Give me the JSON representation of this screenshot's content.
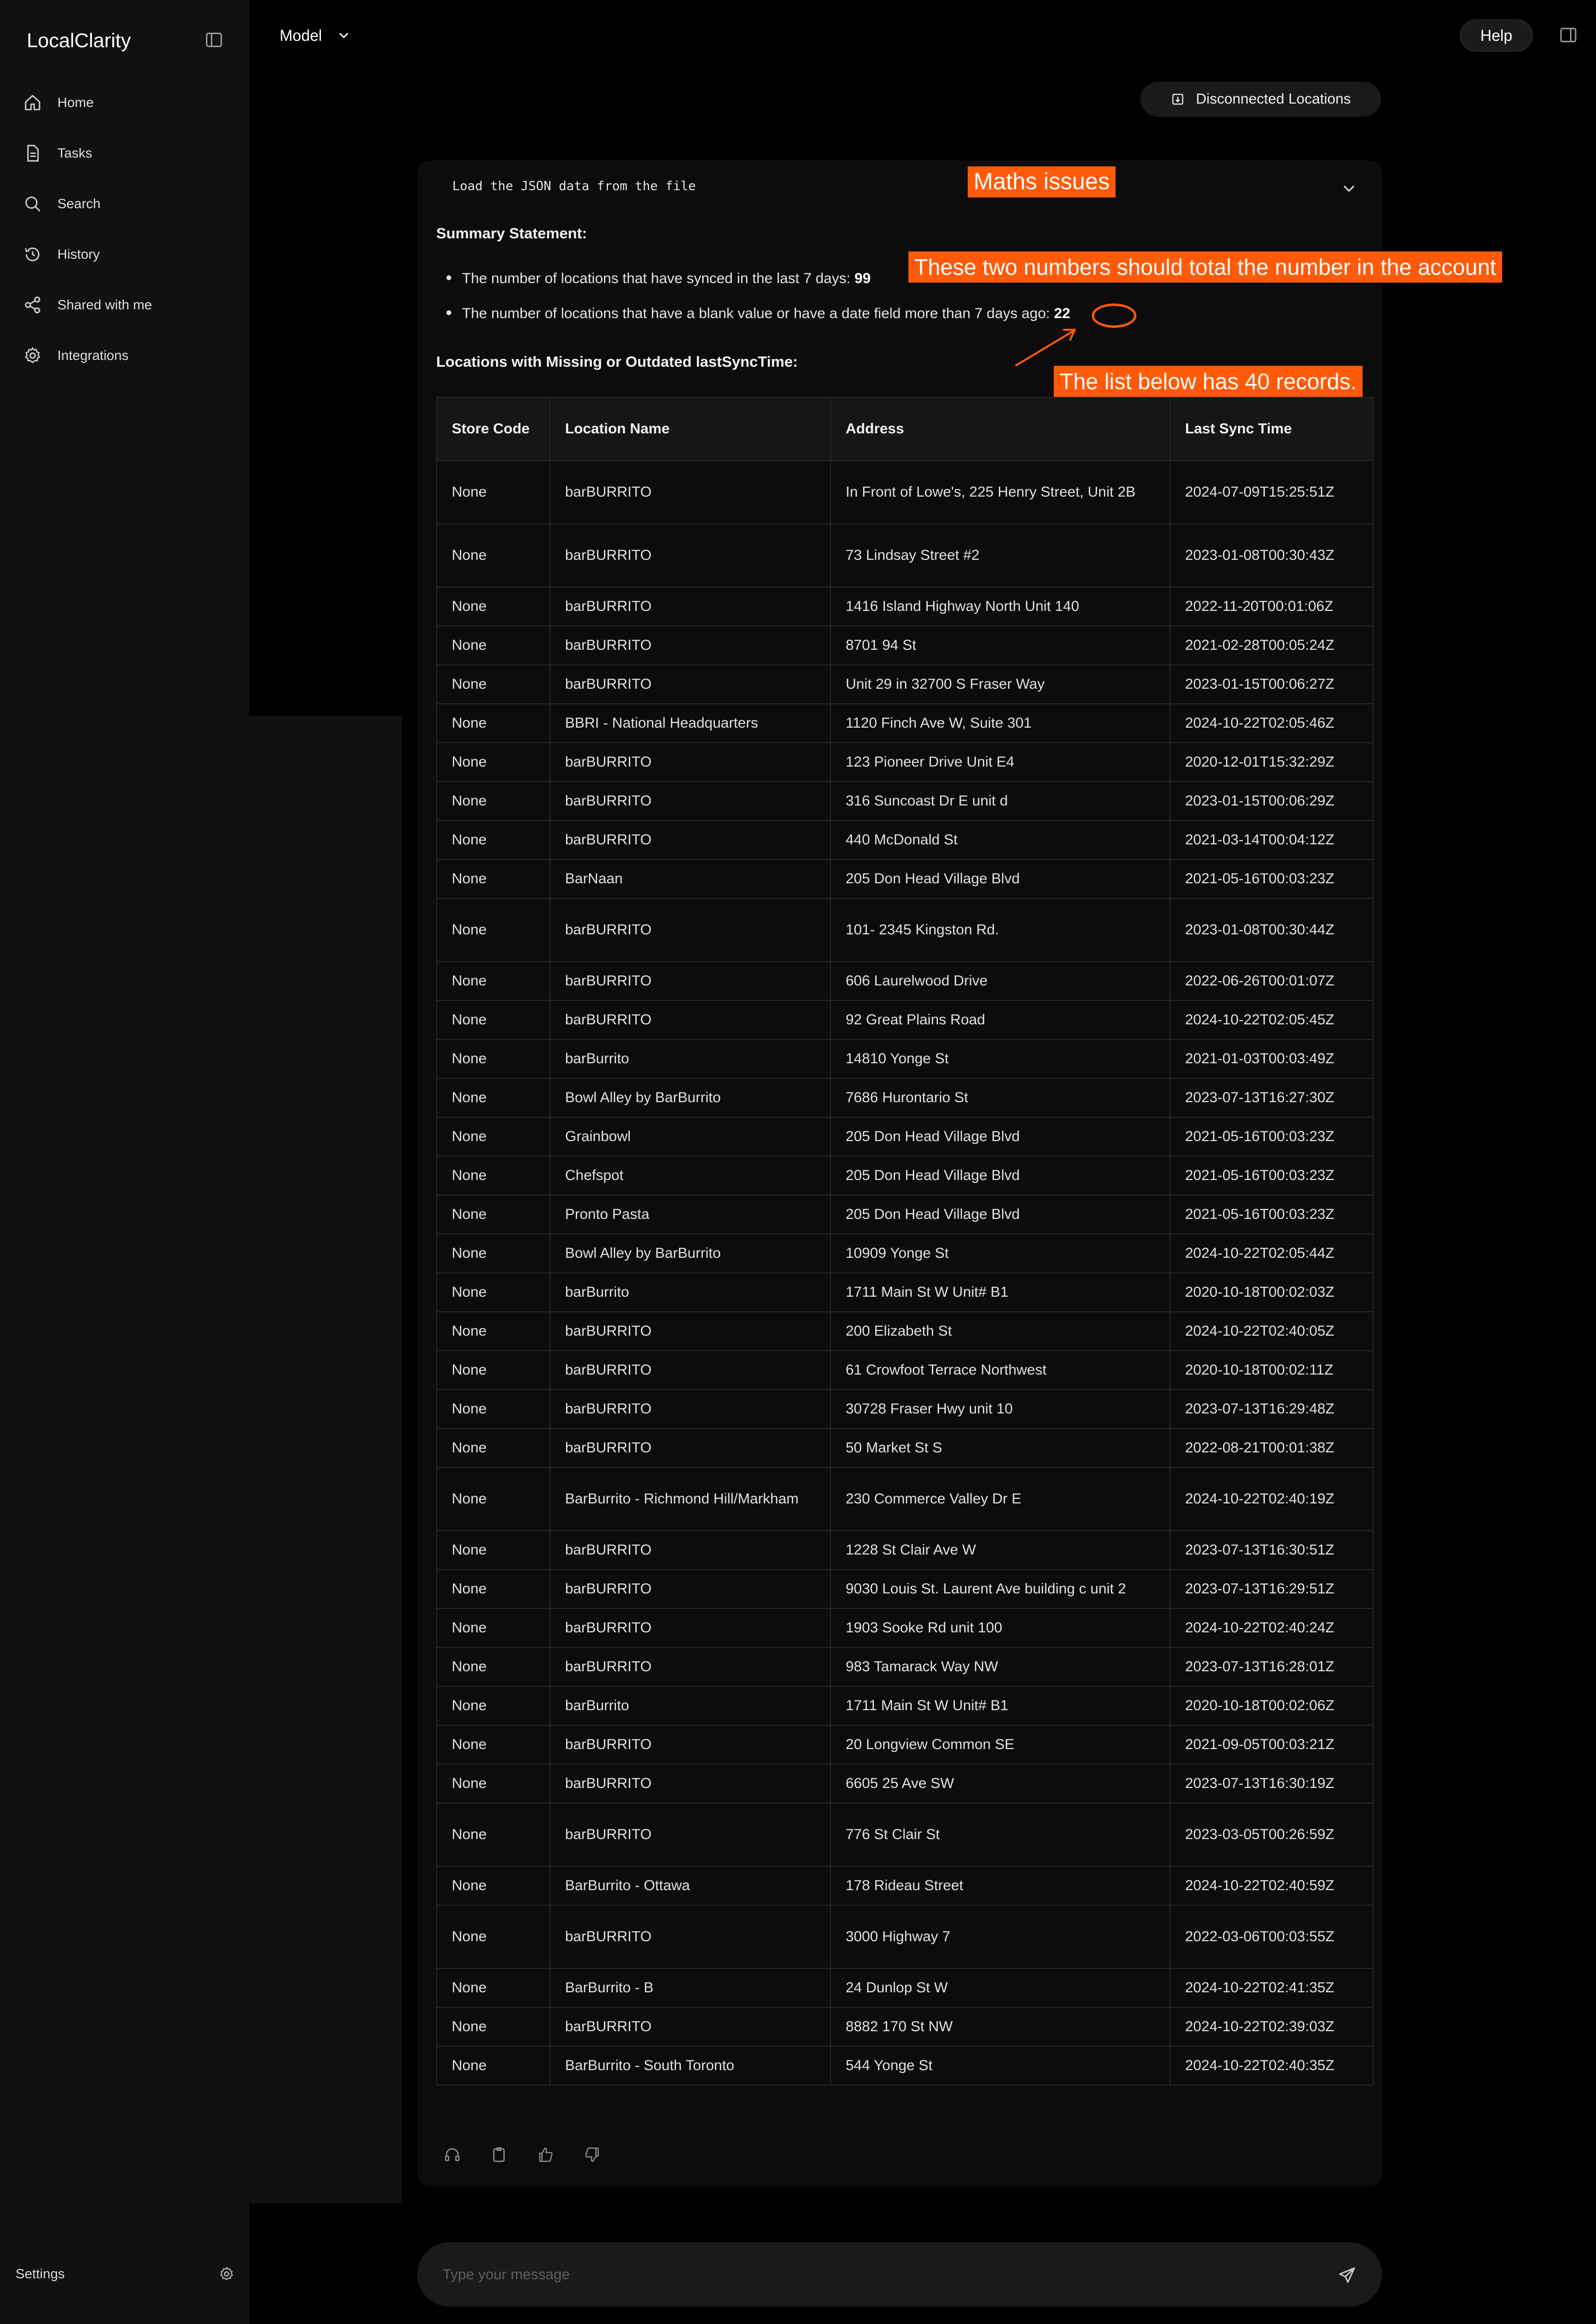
{
  "app": {
    "name": "LocalClarity"
  },
  "sidebar": {
    "items": [
      {
        "label": "Home",
        "icon": "home-icon"
      },
      {
        "label": "Tasks",
        "icon": "document-icon"
      },
      {
        "label": "Search",
        "icon": "search-icon"
      },
      {
        "label": "History",
        "icon": "history-icon"
      },
      {
        "label": "Shared with me",
        "icon": "share-icon"
      },
      {
        "label": "Integrations",
        "icon": "gear-icon"
      }
    ],
    "settings_label": "Settings"
  },
  "header": {
    "model_label": "Model",
    "help_label": "Help",
    "disconnected_label": "Disconnected Locations"
  },
  "response": {
    "code_line": "Load the JSON data from the file",
    "summary_heading": "Summary Statement:",
    "bullet1_text": "The number of locations that have synced in the last 7 days: ",
    "bullet1_value": "99",
    "bullet2_text": "The number of locations that have a blank value or have a date field more than 7 days ago: ",
    "bullet2_value": "22",
    "list_heading": "Locations with Missing or Outdated lastSyncTime:",
    "table": {
      "headers": [
        "Store Code",
        "Location Name",
        "Address",
        "Last Sync Time"
      ],
      "rows": [
        [
          "None",
          "barBURRITO",
          "In Front of Lowe's, 225 Henry Street, Unit 2B",
          "2024-07-09T15:25:51Z"
        ],
        [
          "None",
          "barBURRITO",
          "73 Lindsay Street #2",
          "2023-01-08T00:30:43Z"
        ],
        [
          "None",
          "barBURRITO",
          "1416 Island Highway North Unit 140",
          "2022-11-20T00:01:06Z"
        ],
        [
          "None",
          "barBURRITO",
          "8701 94 St",
          "2021-02-28T00:05:24Z"
        ],
        [
          "None",
          "barBURRITO",
          "Unit 29 in 32700 S Fraser Way",
          "2023-01-15T00:06:27Z"
        ],
        [
          "None",
          "BBRI - National Headquarters",
          "1120 Finch Ave W, Suite 301",
          "2024-10-22T02:05:46Z"
        ],
        [
          "None",
          "barBURRITO",
          "123 Pioneer Drive Unit E4",
          "2020-12-01T15:32:29Z"
        ],
        [
          "None",
          "barBURRITO",
          "316 Suncoast Dr E unit d",
          "2023-01-15T00:06:29Z"
        ],
        [
          "None",
          "barBURRITO",
          "440 McDonald St",
          "2021-03-14T00:04:12Z"
        ],
        [
          "None",
          "BarNaan",
          "205 Don Head Village Blvd",
          "2021-05-16T00:03:23Z"
        ],
        [
          "None",
          "barBURRITO",
          "101- 2345 Kingston Rd.",
          "2023-01-08T00:30:44Z"
        ],
        [
          "None",
          "barBURRITO",
          "606 Laurelwood Drive",
          "2022-06-26T00:01:07Z"
        ],
        [
          "None",
          "barBURRITO",
          "92 Great Plains Road",
          "2024-10-22T02:05:45Z"
        ],
        [
          "None",
          "barBurrito",
          "14810 Yonge St",
          "2021-01-03T00:03:49Z"
        ],
        [
          "None",
          "Bowl Alley by BarBurrito",
          "7686 Hurontario St",
          "2023-07-13T16:27:30Z"
        ],
        [
          "None",
          "Grainbowl",
          "205 Don Head Village Blvd",
          "2021-05-16T00:03:23Z"
        ],
        [
          "None",
          "Chefspot",
          "205 Don Head Village Blvd",
          "2021-05-16T00:03:23Z"
        ],
        [
          "None",
          "Pronto Pasta",
          "205 Don Head Village Blvd",
          "2021-05-16T00:03:23Z"
        ],
        [
          "None",
          "Bowl Alley by BarBurrito",
          "10909 Yonge St",
          "2024-10-22T02:05:44Z"
        ],
        [
          "None",
          "barBurrito",
          "1711 Main St W Unit# B1",
          "2020-10-18T00:02:03Z"
        ],
        [
          "None",
          "barBURRITO",
          "200 Elizabeth St",
          "2024-10-22T02:40:05Z"
        ],
        [
          "None",
          "barBURRITO",
          "61 Crowfoot Terrace Northwest",
          "2020-10-18T00:02:11Z"
        ],
        [
          "None",
          "barBURRITO",
          "30728 Fraser Hwy unit 10",
          "2023-07-13T16:29:48Z"
        ],
        [
          "None",
          "barBURRITO",
          "50 Market St S",
          "2022-08-21T00:01:38Z"
        ],
        [
          "None",
          "BarBurrito - Richmond Hill/Markham",
          "230 Commerce Valley Dr E",
          "2024-10-22T02:40:19Z"
        ],
        [
          "None",
          "barBURRITO",
          "1228 St Clair Ave W",
          "2023-07-13T16:30:51Z"
        ],
        [
          "None",
          "barBURRITO",
          "9030 Louis St. Laurent Ave building c unit 2",
          "2023-07-13T16:29:51Z"
        ],
        [
          "None",
          "barBURRITO",
          "1903 Sooke Rd unit 100",
          "2024-10-22T02:40:24Z"
        ],
        [
          "None",
          "barBURRITO",
          "983 Tamarack Way NW",
          "2023-07-13T16:28:01Z"
        ],
        [
          "None",
          "barBurrito",
          "1711 Main St W Unit# B1",
          "2020-10-18T00:02:06Z"
        ],
        [
          "None",
          "barBURRITO",
          "20 Longview Common SE",
          "2021-09-05T00:03:21Z"
        ],
        [
          "None",
          "barBURRITO",
          "6605 25 Ave SW",
          "2023-07-13T16:30:19Z"
        ],
        [
          "None",
          "barBURRITO",
          "776 St Clair St",
          "2023-03-05T00:26:59Z"
        ],
        [
          "None",
          "BarBurrito - Ottawa",
          "178 Rideau Street",
          "2024-10-22T02:40:59Z"
        ],
        [
          "None",
          "barBURRITO",
          "3000 Highway 7",
          "2022-03-06T00:03:55Z"
        ],
        [
          "None",
          "BarBurrito - B",
          "24 Dunlop St W",
          "2024-10-22T02:41:35Z"
        ],
        [
          "None",
          "barBURRITO",
          "8882 170 St NW",
          "2024-10-22T02:39:03Z"
        ],
        [
          "None",
          "BarBurrito - South Toronto",
          "544 Yonge St",
          "2024-10-22T02:40:35Z"
        ]
      ]
    }
  },
  "composer": {
    "placeholder": "Type your message"
  },
  "annotations": {
    "maths": "Maths issues",
    "totals": "These two numbers should total the number in the account",
    "count": "The list below has 40 records."
  },
  "colors": {
    "accent": "#ff5a0a",
    "background": "#000000",
    "sidebar": "#111111"
  }
}
